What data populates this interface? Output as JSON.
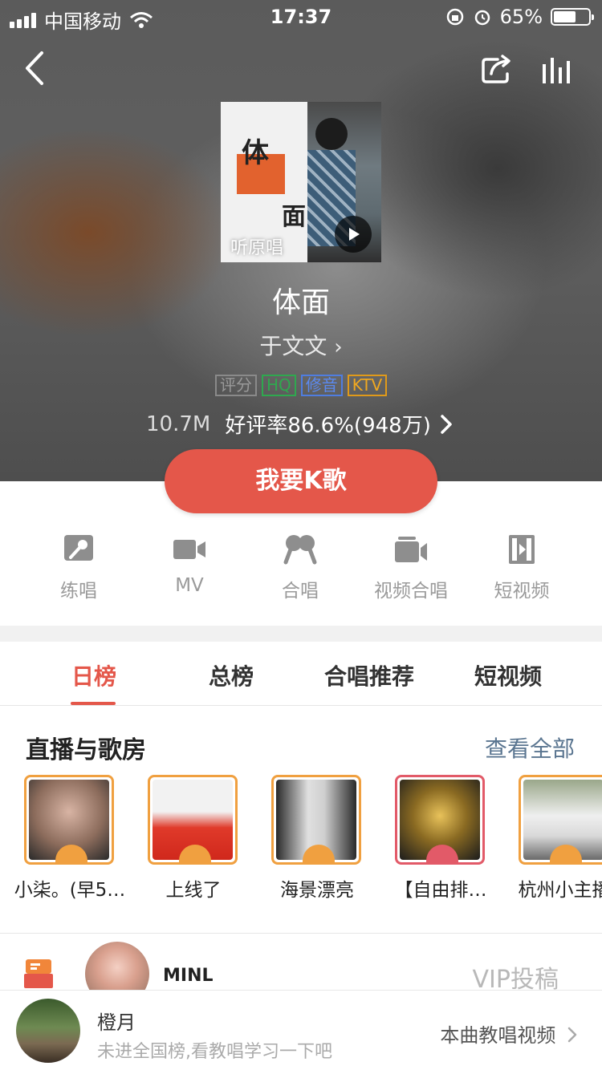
{
  "status_bar": {
    "carrier": "中国移动",
    "time": "17:37",
    "battery": "65%",
    "battery_level": 0.65
  },
  "header": {
    "back_icon": "chevron-left-icon",
    "share_icon": "share-icon",
    "chart_icon": "bars-icon"
  },
  "cover": {
    "char_top": "体",
    "char_bottom": "面",
    "listen_label": "听原唱",
    "play_icon": "play-icon"
  },
  "song": {
    "title": "体面",
    "artist": "于文文",
    "tags": [
      "评分",
      "HQ",
      "修音",
      "KTV"
    ],
    "plays": "10.7M",
    "rating": "好评率86.6%(948万)"
  },
  "cta": {
    "label": "我要K歌",
    "color": "#e4574a"
  },
  "actions": [
    {
      "label": "练唱",
      "icon": "mic-practice-icon"
    },
    {
      "label": "MV",
      "icon": "video-camera-icon"
    },
    {
      "label": "合唱",
      "icon": "duet-mic-icon"
    },
    {
      "label": "视频合唱",
      "icon": "video-duet-icon"
    },
    {
      "label": "短视频",
      "icon": "short-video-icon"
    }
  ],
  "tabs": [
    {
      "label": "日榜",
      "active": true
    },
    {
      "label": "总榜",
      "active": false
    },
    {
      "label": "合唱推荐",
      "active": false
    },
    {
      "label": "短视频",
      "active": false
    }
  ],
  "live": {
    "title": "直播与歌房",
    "see_all": "查看全部",
    "rooms": [
      {
        "name": "小柒。(早5…",
        "type": "video"
      },
      {
        "name": "上线了",
        "type": "video"
      },
      {
        "name": "海景漂亮",
        "type": "video"
      },
      {
        "name": "【自由排…",
        "type": "room"
      },
      {
        "name": "杭州小主播",
        "type": "video"
      }
    ]
  },
  "contribution": {
    "user": "MINL",
    "label": "VIP投稿"
  },
  "bottom_bar": {
    "username": "橙月",
    "hint": "未进全国榜,看教唱学习一下吧",
    "teach_link": "本曲教唱视频"
  }
}
